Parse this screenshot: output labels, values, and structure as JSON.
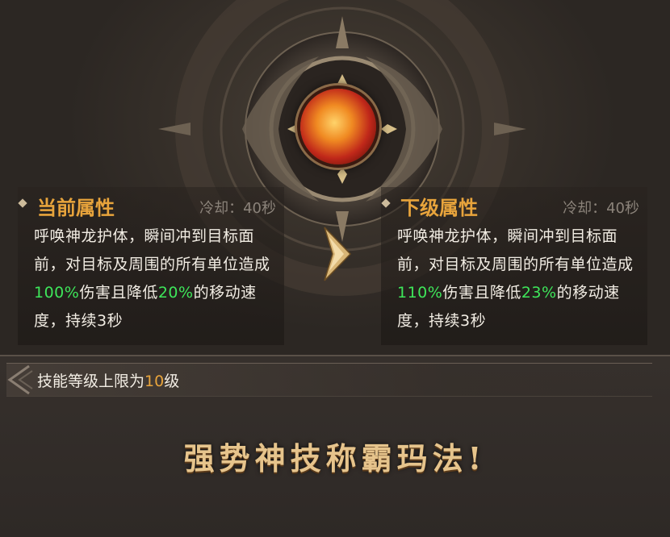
{
  "skill": {
    "icon": "dragon-claw-skill-icon"
  },
  "current": {
    "title": "当前属性",
    "cooldown": "冷却：40秒",
    "desc_prefix": "呼唤神龙护体，瞬间冲到目标面前，对目标及周围的所有单位造成",
    "damage": "100%",
    "desc_mid": "伤害且降低",
    "slow": "20%",
    "desc_suffix": "的移动速度，持续3秒"
  },
  "next": {
    "title": "下级属性",
    "cooldown": "冷却：40秒",
    "desc_prefix": "呼唤神龙护体，瞬间冲到目标面前，对目标及周围的所有单位造成",
    "damage": "110%",
    "desc_mid": "伤害且降低",
    "slow": "23%",
    "desc_suffix": "的移动速度，持续3秒"
  },
  "level_cap": {
    "prefix": "技能等级上限为",
    "value": "10",
    "suffix": "级"
  },
  "slogan": "强势神技称霸玛法!",
  "colors": {
    "accent_orange": "#e8a43c",
    "highlight_green": "#3ee65a",
    "text_light": "#f2ede4",
    "muted": "#8b837a"
  }
}
